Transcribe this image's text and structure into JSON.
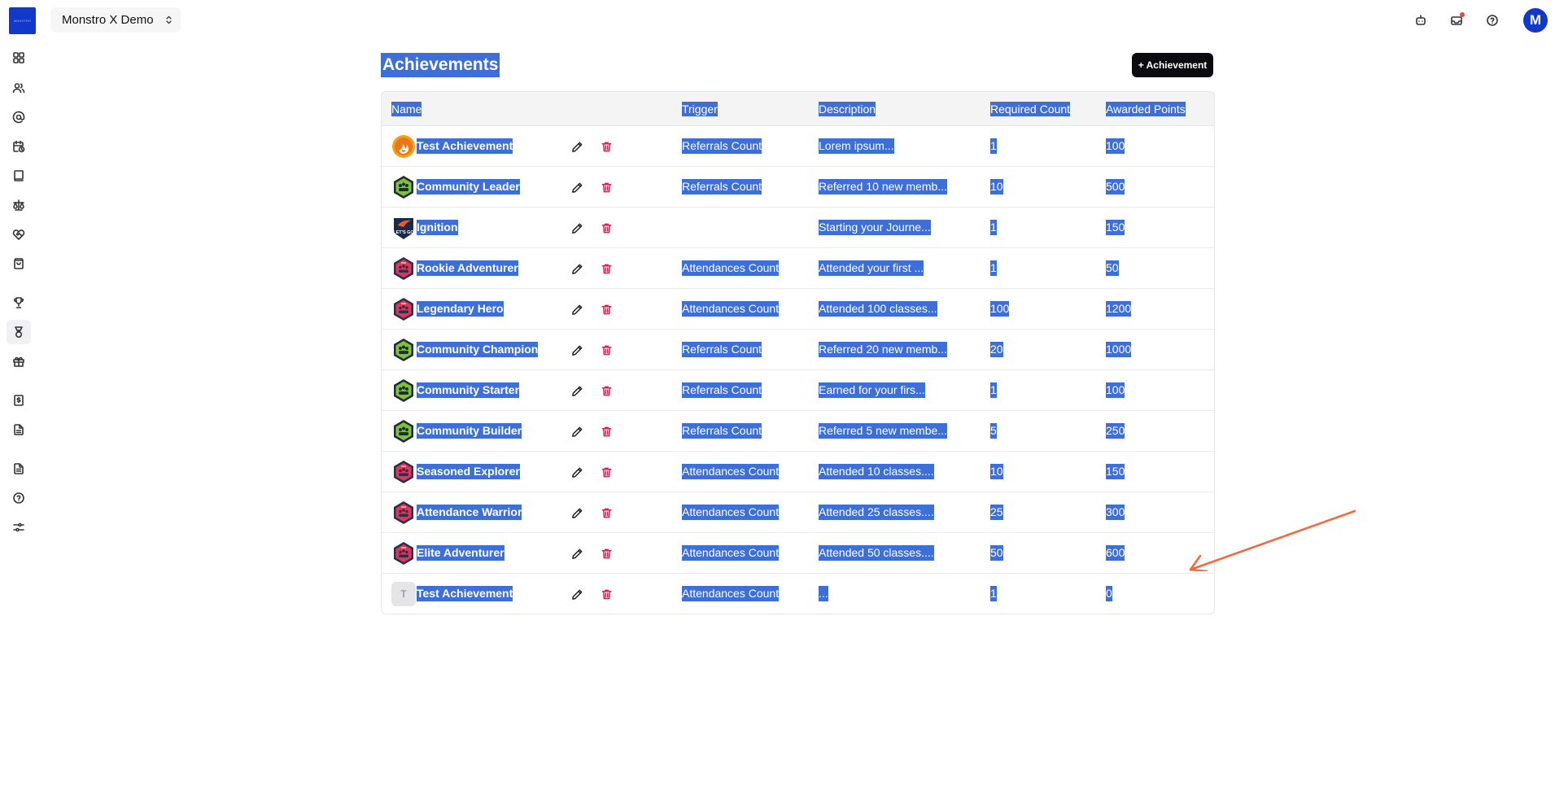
{
  "header": {
    "workspace_name": "Monstro X Demo",
    "logo_text": "MONSTRO",
    "avatar_initial": "M",
    "icons": [
      "bot-icon",
      "inbox-icon",
      "help-icon"
    ]
  },
  "sidebar": {
    "items": [
      {
        "icon": "dashboard-icon"
      },
      {
        "icon": "users-icon"
      },
      {
        "icon": "at-sign-icon"
      },
      {
        "icon": "calendar-clock-icon"
      },
      {
        "icon": "book-icon"
      },
      {
        "icon": "scale-icon"
      },
      {
        "icon": "heart-handshake-icon"
      },
      {
        "icon": "shopping-bag-icon"
      },
      {
        "icon": "trophy-icon"
      },
      {
        "icon": "achievement-badge-icon",
        "active": true
      },
      {
        "icon": "gift-icon"
      },
      {
        "icon": "dollar-document-icon"
      },
      {
        "icon": "document-icon"
      },
      {
        "icon": "document-lines-icon"
      },
      {
        "icon": "help-circle-icon"
      },
      {
        "icon": "settings-sliders-icon"
      }
    ]
  },
  "page": {
    "title": "Achievements",
    "add_button": "+ Achievement"
  },
  "table": {
    "columns": [
      "Name",
      "Trigger",
      "Description",
      "Required Count",
      "Awarded Points"
    ],
    "rows": [
      {
        "badge": "flame",
        "name": "Test Achievement",
        "trigger": "Referrals Count",
        "description": "Lorem ipsum...",
        "required": "1",
        "points": "100"
      },
      {
        "badge": "green",
        "name": "Community Leader",
        "trigger": "Referrals Count",
        "description": "Referred 10 new memb...",
        "required": "10",
        "points": "500"
      },
      {
        "badge": "dark",
        "name": "Ignition",
        "trigger": "",
        "description": "Starting your Journe...",
        "required": "1",
        "points": "150"
      },
      {
        "badge": "red",
        "name": "Rookie Adventurer",
        "trigger": "Attendances Count",
        "description": "Attended your first ...",
        "required": "1",
        "points": "50"
      },
      {
        "badge": "red",
        "name": "Legendary Hero",
        "trigger": "Attendances Count",
        "description": "Attended 100 classes...",
        "required": "100",
        "points": "1200"
      },
      {
        "badge": "green",
        "name": "Community Champion",
        "trigger": "Referrals Count",
        "description": "Referred 20 new memb...",
        "required": "20",
        "points": "1000"
      },
      {
        "badge": "green",
        "name": "Community Starter",
        "trigger": "Referrals Count",
        "description": "Earned for your firs...",
        "required": "1",
        "points": "100"
      },
      {
        "badge": "green",
        "name": "Community Builder",
        "trigger": "Referrals Count",
        "description": "Referred 5 new membe...",
        "required": "5",
        "points": "250"
      },
      {
        "badge": "red",
        "name": "Seasoned Explorer",
        "trigger": "Attendances Count",
        "description": "Attended 10 classes....",
        "required": "10",
        "points": "150"
      },
      {
        "badge": "red",
        "name": "Attendance Warrior",
        "trigger": "Attendances Count",
        "description": "Attended 25 classes....",
        "required": "25",
        "points": "300"
      },
      {
        "badge": "red",
        "name": "Elite Adventurer",
        "trigger": "Attendances Count",
        "description": "Attended 50 classes....",
        "required": "50",
        "points": "600"
      },
      {
        "badge": "letter",
        "badge_letter": "T",
        "name": "Test Achievement",
        "trigger": "Attendances Count",
        "description": "...",
        "required": "1",
        "points": "0"
      }
    ]
  },
  "colors": {
    "brand": "#1238c9",
    "selection": "#3e6fd8",
    "delete": "#e11d48",
    "annotation_arrow": "#f26a3d"
  }
}
